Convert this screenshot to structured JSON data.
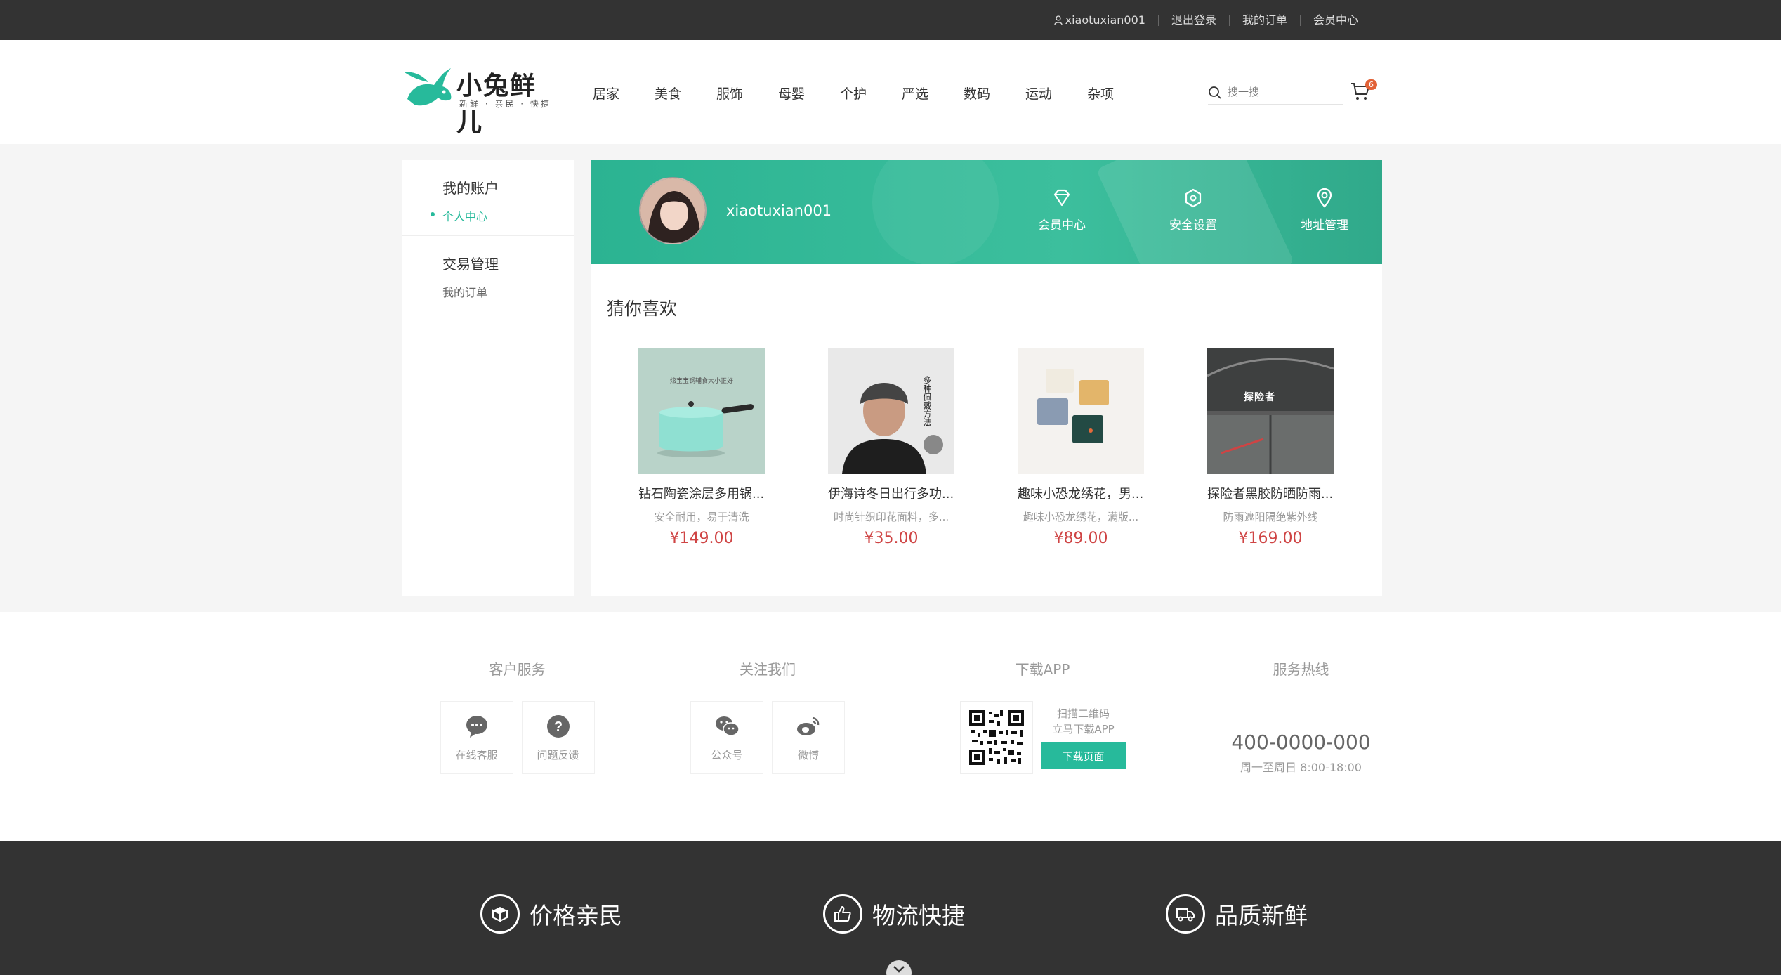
{
  "topbar": {
    "username": "xiaotuxian001",
    "logout": "退出登录",
    "orders": "我的订单",
    "member": "会员中心"
  },
  "header": {
    "logo_text": "小兔鲜儿",
    "logo_sub": "新鲜 · 亲民 · 快捷",
    "nav": [
      "居家",
      "美食",
      "服饰",
      "母婴",
      "个护",
      "严选",
      "数码",
      "运动",
      "杂项"
    ],
    "search_placeholder": "搜一搜",
    "cart_count": "6"
  },
  "sidebar": {
    "group1_title": "我的账户",
    "group1_link": "个人中心",
    "group2_title": "交易管理",
    "group2_link": "我的订单"
  },
  "banner": {
    "username": "xiaotuxian001",
    "items": [
      "会员中心",
      "安全设置",
      "地址管理"
    ]
  },
  "guess": {
    "title": "猜你喜欢",
    "goods": [
      {
        "name": "钻石陶瓷涂层多用锅...",
        "desc": "安全耐用，易于清洗",
        "price": "¥149.00",
        "img_text": "炫宝宝钢辅食大小正好"
      },
      {
        "name": "伊海诗冬日出行多功...",
        "desc": "时尚针织印花面料，多...",
        "price": "¥35.00",
        "img_text": "多种佩戴方法"
      },
      {
        "name": "趣味小恐龙绣花，男...",
        "desc": "趣味小恐龙绣花，满版...",
        "price": "¥89.00",
        "img_text": ""
      },
      {
        "name": "探险者黑胶防晒防雨...",
        "desc": "防雨遮阳隔绝紫外线",
        "price": "¥169.00",
        "img_text": "探险者"
      }
    ]
  },
  "service": {
    "col1": {
      "title": "客户服务",
      "boxes": [
        "在线客服",
        "问题反馈"
      ]
    },
    "col2": {
      "title": "关注我们",
      "boxes": [
        "公众号",
        "微博"
      ]
    },
    "col3": {
      "title": "下载APP",
      "line1": "扫描二维码",
      "line2": "立马下载APP",
      "button": "下载页面"
    },
    "col4": {
      "title": "服务热线",
      "phone": "400-0000-000",
      "hours": "周一至周日 8:00-18:00"
    }
  },
  "footer": {
    "promises": [
      "价格亲民",
      "物流快捷",
      "品质新鲜"
    ]
  },
  "colors": {
    "accent": "#27ba9b",
    "price": "#cf4444",
    "dark": "#333333"
  }
}
